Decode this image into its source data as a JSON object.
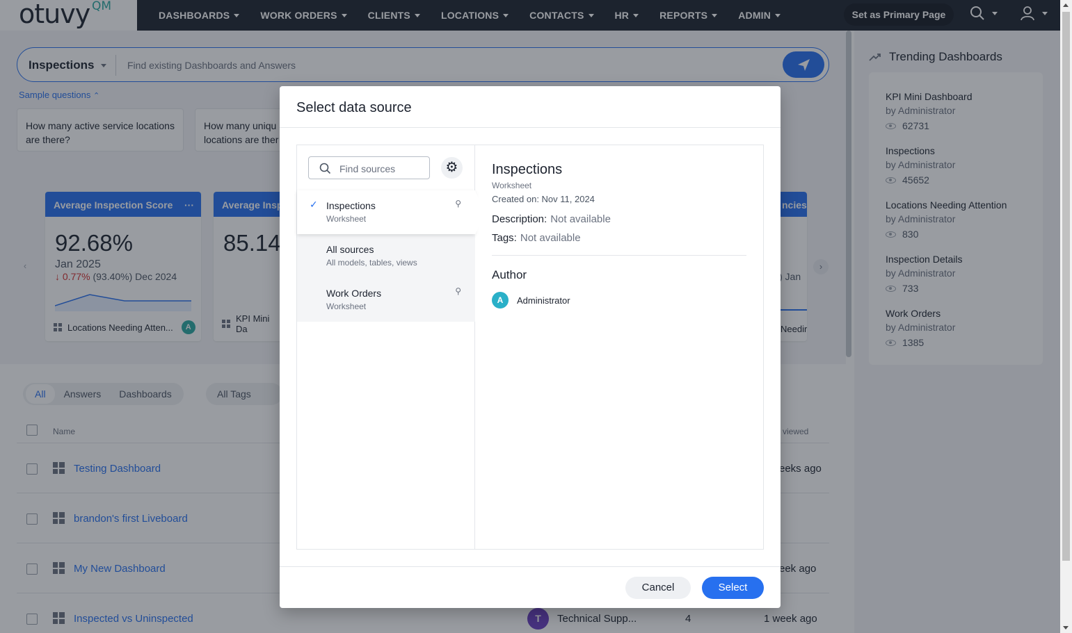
{
  "app": {
    "logo_word": "otuvy",
    "logo_mark": "QM"
  },
  "nav": {
    "items": [
      "DASHBOARDS",
      "WORK ORDERS",
      "CLIENTS",
      "LOCATIONS",
      "CONTACTS",
      "HR",
      "REPORTS",
      "ADMIN"
    ],
    "primary_button": "Set as Primary Page"
  },
  "search": {
    "source": "Inspections",
    "placeholder": "Find existing Dashboards and Answers"
  },
  "sample_questions": {
    "toggle": "Sample questions",
    "items": [
      "How many active service locations are there?",
      "How many uniqu locations are ther"
    ]
  },
  "kpi_cards": [
    {
      "title": "Average Inspection Score",
      "value": "92.68%",
      "date": "Jan 2025",
      "change": "↓ 0.77%",
      "change_rest": "(93.40%) Dec 2024",
      "footer": "Locations Needing Atten...",
      "avatar": "A"
    },
    {
      "title": "Average Insp",
      "value": "85.14",
      "footer": "KPI Mini Da"
    },
    {
      "title": "ncies",
      "partial": ") Jan",
      "footer": "Needir"
    }
  ],
  "filters": {
    "tabs": [
      "All",
      "Answers",
      "Dashboards"
    ],
    "tags": "All Tags"
  },
  "table": {
    "col_name": "Name",
    "col_viewed": "viewed",
    "rows": [
      {
        "name": "Testing Dashboard",
        "viewed": "eeks ago"
      },
      {
        "name": "brandon's first Liveboard",
        "viewed": ""
      },
      {
        "name": "My New Dashboard",
        "viewed": "eek ago"
      },
      {
        "name": "Inspected vs Uninspected",
        "author_initial": "T",
        "author": "Technical Supp...",
        "views": "4",
        "viewed": "1 week ago"
      }
    ]
  },
  "trending": {
    "title": "Trending Dashboards",
    "items": [
      {
        "name": "KPI Mini Dashboard",
        "by": "by Administrator",
        "views": "62731"
      },
      {
        "name": "Inspections",
        "by": "by Administrator",
        "views": "45652"
      },
      {
        "name": "Locations Needing Attention",
        "by": "by Administrator",
        "views": "830"
      },
      {
        "name": "Inspection Details",
        "by": "by Administrator",
        "views": "733"
      },
      {
        "name": "Work Orders",
        "by": "by Administrator",
        "views": "1385"
      }
    ]
  },
  "modal": {
    "title": "Select data source",
    "find_placeholder": "Find sources",
    "sources": [
      {
        "name": "Inspections",
        "sub": "Worksheet"
      },
      {
        "name": "All sources",
        "sub": "All models, tables, views"
      },
      {
        "name": "Work Orders",
        "sub": "Worksheet"
      }
    ],
    "detail": {
      "name": "Inspections",
      "type": "Worksheet",
      "created": "Created on: Nov 11, 2024",
      "description_label": "Description:",
      "description": "Not available",
      "tags_label": "Tags:",
      "tags": "Not available",
      "author_heading": "Author",
      "author_initial": "A",
      "author": "Administrator"
    },
    "cancel": "Cancel",
    "select": "Select"
  }
}
